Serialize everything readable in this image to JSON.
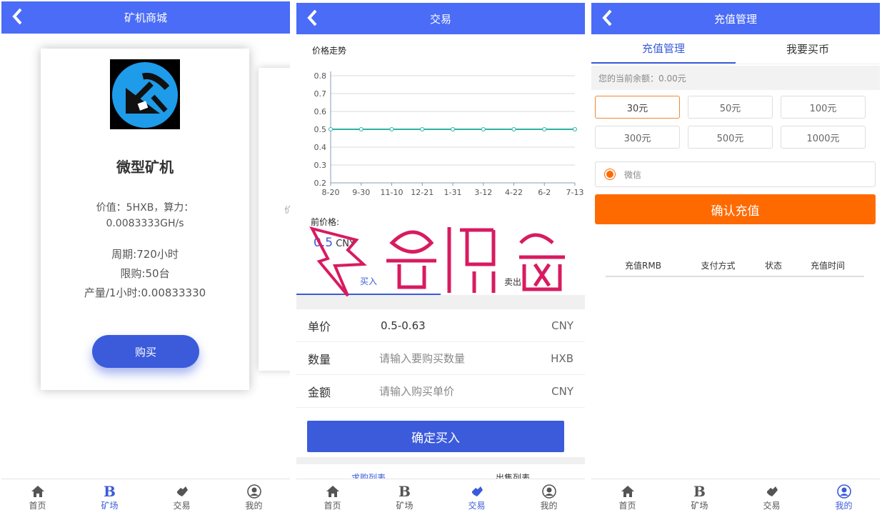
{
  "screens": {
    "mall": {
      "title": "矿机商城",
      "product": {
        "name": "微型矿机",
        "value_line": "价值：5HXB，算力：",
        "hashrate": "0.0083333GH/s",
        "cycle": "周期:720小时",
        "limit": "限购:50台",
        "output": "产量/1小时:0.00833330",
        "buy_label": "购买"
      },
      "peek_text": "价"
    },
    "trade": {
      "title": "交易",
      "chart_title": "价格走势",
      "chart_data": {
        "type": "line",
        "title": "价格走势",
        "categories": [
          "8-20",
          "9-30",
          "11-10",
          "12-21",
          "1-31",
          "3-12",
          "4-22",
          "6-2",
          "7-13"
        ],
        "series": [
          {
            "values": [
              0.5,
              0.5,
              0.5,
              0.5,
              0.5,
              0.5,
              0.5,
              0.5,
              0.5
            ]
          }
        ],
        "y_ticks": [
          "0.8",
          "0.7",
          "0.6",
          "0.5",
          "0.4",
          "0.3",
          "0.2"
        ],
        "ylim": [
          0.2,
          0.8
        ],
        "grid": true,
        "color": "#2ab3a3"
      },
      "current_price_label": "前价格:",
      "current_price_value": "0.5",
      "current_price_unit": "CNY",
      "sub_tabs": {
        "buy": "买入",
        "sell": "卖出"
      },
      "form": {
        "price_label": "单价",
        "price_value": "0.5-0.63",
        "price_unit": "CNY",
        "qty_label": "数量",
        "qty_placeholder": "请输入要购买数量",
        "qty_unit": "HXB",
        "amount_label": "金额",
        "amount_placeholder": "请输入购买单价",
        "amount_unit": "CNY"
      },
      "confirm_label": "确定买入",
      "list_tabs": {
        "buy_list": "求购列表",
        "sell_list": "出售列表"
      }
    },
    "recharge": {
      "title": "充值管理",
      "tabs": {
        "manage": "充值管理",
        "buy_coin": "我要买币"
      },
      "balance": "您的当前余额：0.00元",
      "amounts": [
        "30元",
        "50元",
        "100元",
        "300元",
        "500元",
        "1000元"
      ],
      "pay_method": "微信",
      "confirm_label": "确认充值",
      "table_headers": [
        "充值RMB",
        "支付方式",
        "状态",
        "充值时间"
      ]
    }
  },
  "tabbar": {
    "home": "首页",
    "mine_field": "矿场",
    "trade": "交易",
    "mine": "我的",
    "b_glyph": "B"
  },
  "colors": {
    "primary": "#4a6cf7",
    "button": "#3b5bdb",
    "orange": "#ff6a00",
    "line": "#2ab3a3"
  }
}
